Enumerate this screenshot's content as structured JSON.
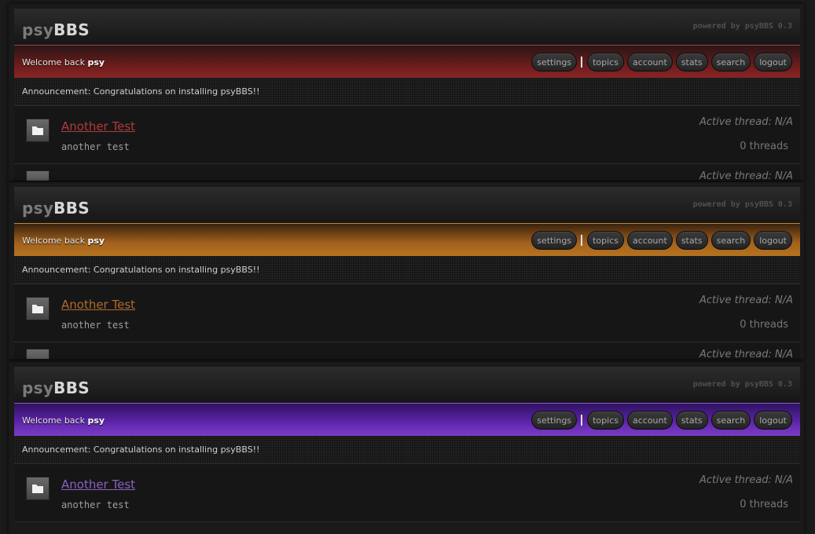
{
  "themes": [
    {
      "name": "red",
      "header": {
        "logo_prefix": "psy",
        "logo_suffix": "BBS",
        "powered_by": "powered by psyBBS 0.3"
      },
      "welcome": {
        "text": "Welcome back",
        "user": "psy"
      },
      "nav": [
        "settings",
        "topics",
        "account",
        "stats",
        "search",
        "logout"
      ],
      "announcement": "Announcement: Congratulations on installing psyBBS!!",
      "topic": {
        "title": "Another Test",
        "description": "another test",
        "active_thread": "Active thread: N/A",
        "threads": "0 threads"
      },
      "accent": "#8a2424"
    },
    {
      "name": "orange",
      "header": {
        "logo_prefix": "psy",
        "logo_suffix": "BBS",
        "powered_by": "powered by psyBBS 0.3"
      },
      "welcome": {
        "text": "Welcome back",
        "user": "psy"
      },
      "nav": [
        "settings",
        "topics",
        "account",
        "stats",
        "search",
        "logout"
      ],
      "announcement": "Announcement: Congratulations on installing psyBBS!!",
      "topic": {
        "title": "Another Test",
        "description": "another test",
        "active_thread": "Active thread: N/A",
        "threads": "0 threads"
      },
      "accent": "#b5721f"
    },
    {
      "name": "purple",
      "header": {
        "logo_prefix": "psy",
        "logo_suffix": "BBS",
        "powered_by": "powered by psyBBS 0.3"
      },
      "welcome": {
        "text": "Welcome back",
        "user": "psy"
      },
      "nav": [
        "settings",
        "topics",
        "account",
        "stats",
        "search",
        "logout"
      ],
      "announcement": "Announcement: Congratulations on installing psyBBS!!",
      "topic": {
        "title": "Another Test",
        "description": "another test",
        "active_thread": "Active thread: N/A",
        "threads": "0 threads"
      },
      "accent": "#7a3ec6"
    }
  ],
  "peek": {
    "active_thread": "Active thread: N/A"
  }
}
